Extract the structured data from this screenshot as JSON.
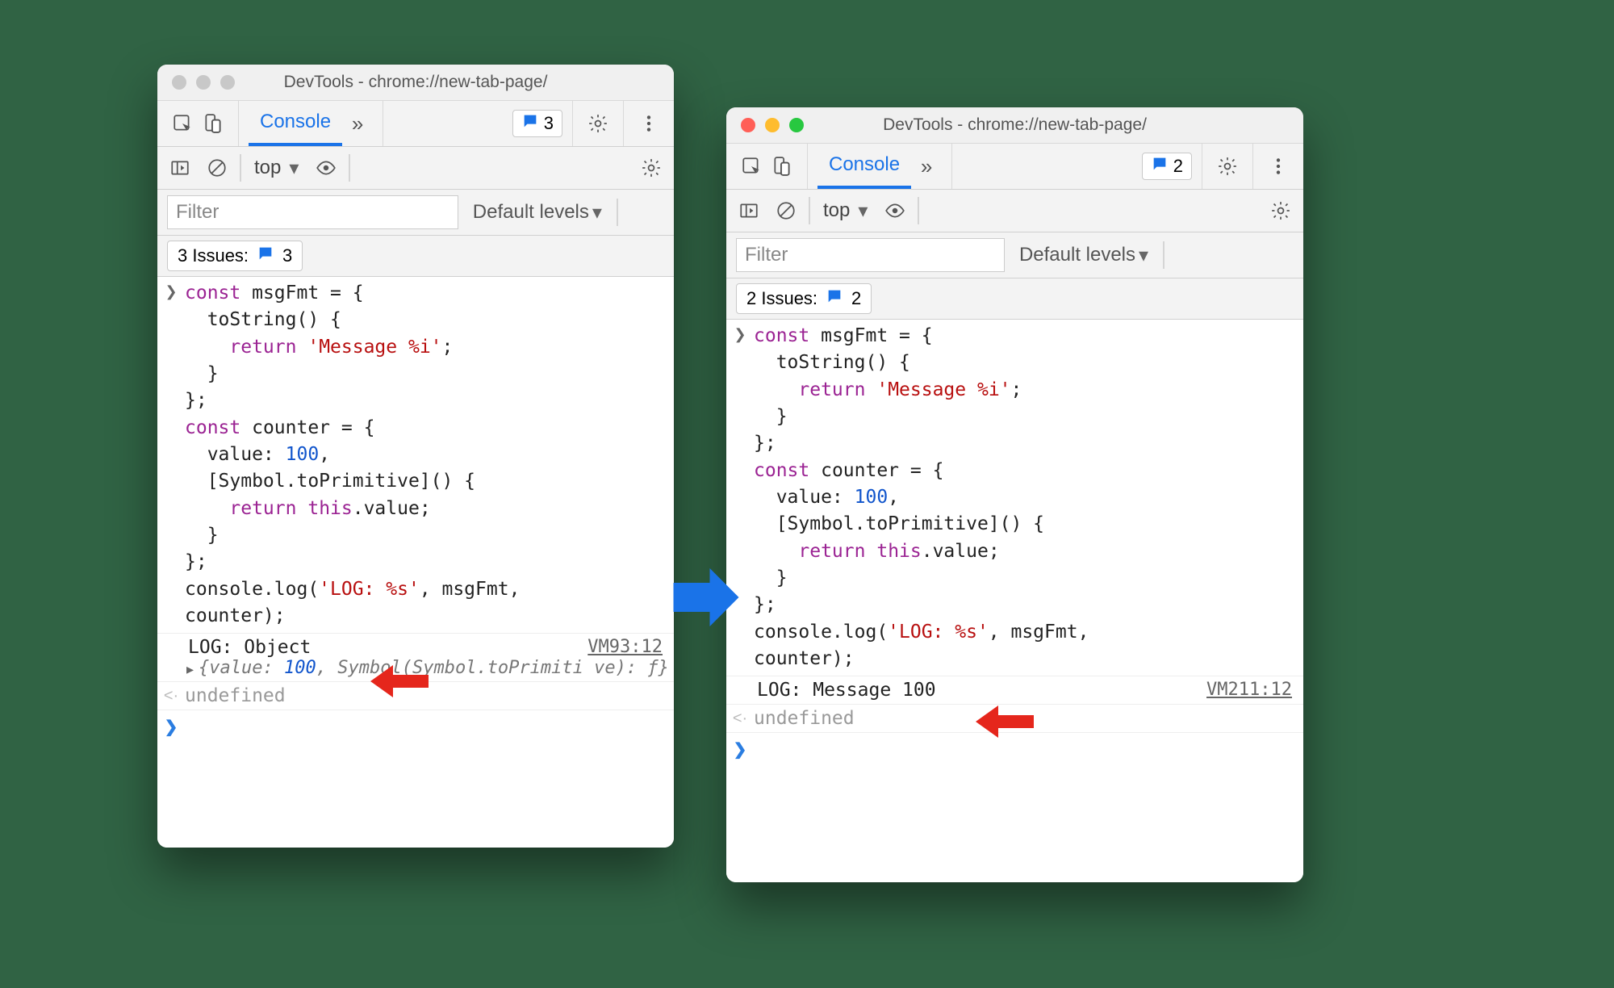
{
  "windows": {
    "left": {
      "title": "DevTools - chrome://new-tab-page/",
      "tab": "Console",
      "pill_count": "3",
      "context": "top",
      "filter_placeholder": "Filter",
      "levels_label": "Default levels",
      "issues_label": "3 Issues:",
      "issues_count": "3",
      "log_output": "LOG: Object",
      "log_source": "VM93:12",
      "obj_preview_a": "{value: ",
      "obj_preview_num": "100",
      "obj_preview_b": ", Symbol(Symbol.toPrimiti\nve): ƒ}",
      "undefined": "undefined"
    },
    "right": {
      "title": "DevTools - chrome://new-tab-page/",
      "tab": "Console",
      "pill_count": "2",
      "context": "top",
      "filter_placeholder": "Filter",
      "levels_label": "Default levels",
      "issues_label": "2 Issues:",
      "issues_count": "2",
      "log_output": "LOG: Message 100",
      "log_source": "VM211:12",
      "undefined": "undefined"
    }
  },
  "code": {
    "l01a": "const",
    "l01b": " msgFmt = {",
    "l02": "  toString() {",
    "l03a": "    ",
    "l03b": "return",
    "l03c": " ",
    "l03d": "'Message %i'",
    "l03e": ";",
    "l04": "  }",
    "l05": "};",
    "l06a": "const",
    "l06b": " counter = {",
    "l07a": "  value: ",
    "l07b": "100",
    "l07c": ",",
    "l08": "  [Symbol.toPrimitive]() {",
    "l09a": "    ",
    "l09b": "return",
    "l09c": " ",
    "l09d": "this",
    "l09e": ".value;",
    "l10": "  }",
    "l11": "};",
    "l12a": "console.log(",
    "l12b": "'LOG: %s'",
    "l12c": ", msgFmt,",
    "l13": "counter);"
  }
}
